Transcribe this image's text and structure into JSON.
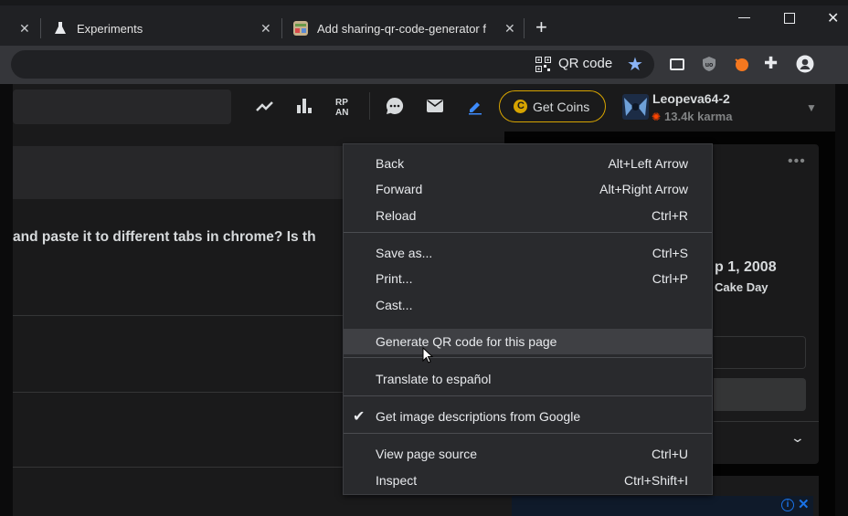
{
  "tabs": [
    {
      "label": ""
    },
    {
      "label": "Experiments"
    },
    {
      "label": "Add sharing-qr-code-generator f"
    }
  ],
  "toolbar": {
    "qr_chip_label": "QR code"
  },
  "site_header": {
    "get_coins_label": "Get Coins",
    "username": "Leopeva64-2",
    "karma": "13.4k karma"
  },
  "post": {
    "title_fragment": "and paste it to different tabs in chrome? Is th"
  },
  "sidebar": {
    "cake_date_fragment": "p 1, 2008",
    "cake_label_fragment": "Cake Day"
  },
  "context_menu": {
    "items": [
      {
        "label": "Back",
        "shortcut": "Alt+Left Arrow"
      },
      {
        "label": "Forward",
        "shortcut": "Alt+Right Arrow"
      },
      {
        "label": "Reload",
        "shortcut": "Ctrl+R"
      },
      {
        "label": "Save as...",
        "shortcut": "Ctrl+S"
      },
      {
        "label": "Print...",
        "shortcut": "Ctrl+P"
      },
      {
        "label": "Cast...",
        "shortcut": ""
      },
      {
        "label": "Generate QR code for this page",
        "shortcut": ""
      },
      {
        "label": "Translate to español",
        "shortcut": ""
      },
      {
        "label": "Get image descriptions from Google",
        "shortcut": "",
        "checked": true
      },
      {
        "label": "View page source",
        "shortcut": "Ctrl+U"
      },
      {
        "label": "Inspect",
        "shortcut": "Ctrl+Shift+I"
      }
    ]
  },
  "colors": {
    "coin_gold": "#d7a400",
    "star_blue": "#8ab4f8",
    "karma_orange": "#ff4500",
    "ad_close_blue": "#1a73e8"
  }
}
